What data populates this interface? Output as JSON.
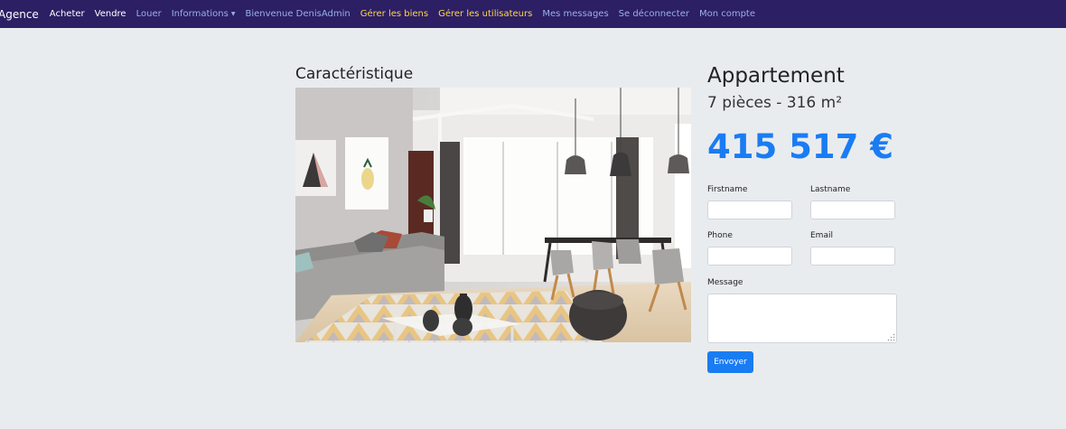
{
  "navbar": {
    "brand": "Agence",
    "items": [
      {
        "label": "Acheter"
      },
      {
        "label": "Vendre"
      },
      {
        "label": "Louer"
      },
      {
        "label": "Informations"
      },
      {
        "label": "Bienvenue DenisAdmin"
      },
      {
        "label": "Gérer les biens"
      },
      {
        "label": "Gérer les utilisateurs"
      },
      {
        "label": "Mes messages"
      },
      {
        "label": "Se déconnecter"
      },
      {
        "label": "Mon compte"
      }
    ],
    "colors": {
      "background": "#2c1f63",
      "link": "#9ab0e6",
      "active": "#ffffff",
      "admin_link": "#ffd54d"
    }
  },
  "property": {
    "section_title": "Caractéristique",
    "photo_icon": "living-room-photo",
    "type": "Appartement",
    "details": "7 pièces - 316 m²",
    "price": "415 517 €",
    "price_color": "#1a7cf3"
  },
  "form": {
    "firstname_label": "Firstname",
    "lastname_label": "Lastname",
    "phone_label": "Phone",
    "email_label": "Email",
    "message_label": "Message",
    "firstname_value": "",
    "lastname_value": "",
    "phone_value": "",
    "email_value": "",
    "message_value": "",
    "submit_label": "Envoyer"
  }
}
